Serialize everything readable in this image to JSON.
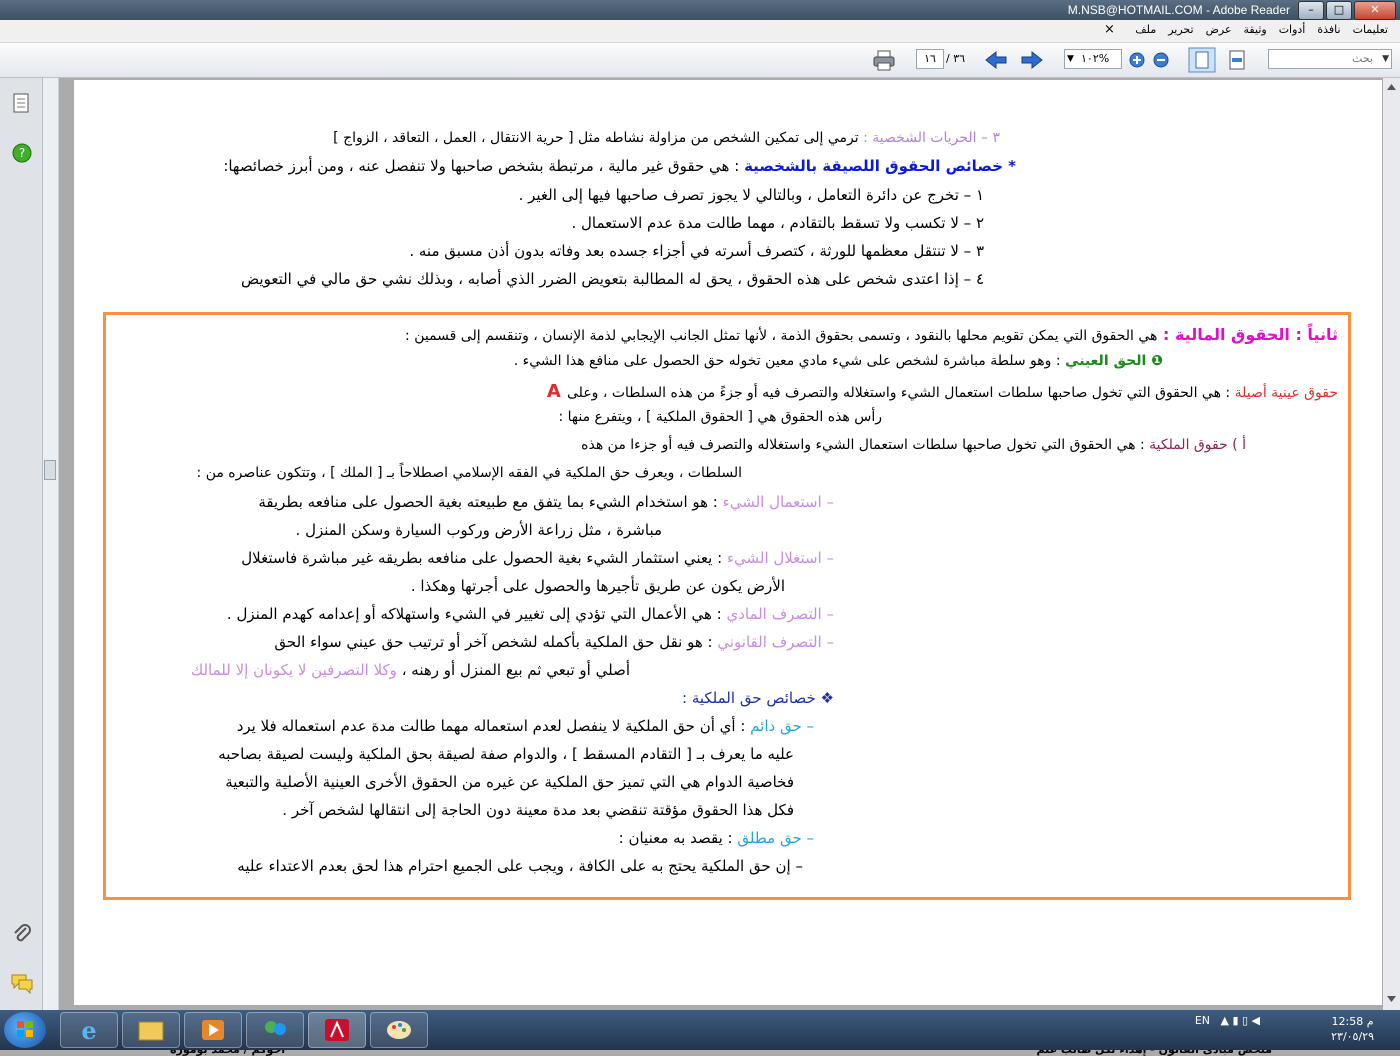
{
  "window": {
    "title": "M.NSB@HOTMAIL.COM - Adobe Reader"
  },
  "menu": {
    "items": [
      "ملف",
      "تحرير",
      "عرض",
      "وثيقة",
      "أدوات",
      "نافذة",
      "تعليمات"
    ],
    "close": "×"
  },
  "toolbar": {
    "search_placeholder": "بحث",
    "zoom": "١٠٢%",
    "page_current": "١٦",
    "page_total": "/ ٣٦"
  },
  "document": {
    "l1_a": "٣ – الحريات الشخصية : ",
    "l1_b": "ترمي إلى تمكين الشخص من مزاولة نشاطه مثل [ حرية الانتقال ، العمل ، التعاقد ، الزواج ]",
    "l2_star": "* ",
    "l2_a": "خصائص الحقوق اللصيقة بالشخصية",
    "l2_b": " : هي حقوق غير مالية ، مرتبطة بشخص صاحبها ولا تنفصل عنه ، ومن أبرز خصائصها:",
    "l3": "١ – تخرج عن دائرة التعامل ، وبالتالي لا يجوز تصرف صاحبها فيها إلى الغير .",
    "l4": "٢ – لا تكسب ولا تسقط بالتقادم ، مهما طالت مدة عدم الاستعمال .",
    "l5": "٣ –   لا تنتقل معظمها للورثة ، كتصرف أسرته في أجزاء جسده بعد وفاته بدون أذن مسبق منه .",
    "l6": "٤ – إذا اعتدى شخص على هذه الحقوق ، يحق له المطالبة بتعويض الضرر الذي أصابه ، وبذلك نشي حق مالي في التعويض",
    "b1_a": "ثانياً : الحقوق المالية : ",
    "b1_b": "هي الحقوق التي يمكن تقويم محلها   بالنقود ، وتسمى بحقوق الذمة ، لأنها تمثل الجانب الإيجابي لذمة الإنسان ، وتنقسم إلى قسمين :",
    "b2_num": "❶",
    "b2_a": " الحق العيني",
    "b2_b": " : وهو سلطة مباشرة لشخص على شيء مادي معين تخوله حق الحصول على منافع هذا الشيء .",
    "b3_a": "A ",
    "b3_b": " حقوق عينية أصيلة",
    "b3_c": " : هي الحقوق التي تخول صاحبها سلطات استعمال الشيء واستغلاله والتصرف فيه أو جزءً من هذه السلطات ، وعلى",
    "b4": "رأس هذه الحقوق هي [ الحقوق الملكية ] ، ويتفرع منها :",
    "b5_a": "أ ) حقوق الملكية",
    "b5_b": " : هي الحقوق التي تخول صاحبها سلطات استعمال الشيء واستغلاله والتصرف فيه أو جزءا من هذه",
    "b6": "السلطات ، ويعرف حق الملكية في الفقه الإسلامي اصطلاحاً بـ [ الملك ] ، وتتكون عناصره من :",
    "b7_a": "–   استعمال الشيء",
    "b7_b": " : هو استخدام الشيء بما يتفق مع طبيعته بغية الحصول على منافعه بطريقة",
    "b8": "مباشرة ، مثل زراعة الأرض وركوب السيارة وسكن المنزل .",
    "b9_a": "–   استغلال الشيء",
    "b9_b": " : يعني استثمار الشيء بغية الحصول على منافعه بطريقه غير مباشرة فاستغلال",
    "b10": "الأرض يكون عن طريق تأجيرها والحصول على أجرتها وهكذا .",
    "b11_a": "–   التصرف المادي",
    "b11_b": " : هي الأعمال التي تؤدي إلى تغيير في الشيء واستهلاكه أو إعدامه كهدم المنزل .",
    "b12_a": "–   التصرف القانوني",
    "b12_b": " : هو نقل حق الملكية بأكمله   لشخص آخر أو ترتيب حق عيني سواء الحق",
    "b13_a": "أصلي أو تبعي ثم بيع المنزل أو رهنه ، ",
    "b13_b": "وكلا التصرفين لا يكونان إلا للمالك",
    "b14": "❖ خصائص حق الملكية :",
    "b15_a": "–   حق دائم",
    "b15_b": " : أي أن حق الملكية لا ينفصل لعدم استعماله مهما طالت مدة عدم استعماله فلا يرد",
    "b16": "عليه ما يعرف بـ [ التقادم المسقط ] ، والدوام صفة لصيقة بحق الملكية وليست لصيقة بصاحبه",
    "b17": "فخاصية الدوام هي التي تميز حق الملكية عن غيره من الحقوق الأخرى العينية الأصلية والتبعية",
    "b18": "فكل هذا الحقوق مؤقتة تنقضي بعد مدة معينة دون الحاجة إلى انتقالها لشخص آخر .",
    "b19_a": "–   حق مطلق",
    "b19_b": " : يقصد به معنيان :",
    "b20": "–   إن حق الملكية يحتج به على الكافة ، ويجب على الجميع احترام هذا لحق بعدم الاعتداء عليه",
    "footer_right": "ملخص مبادئ القانون  -   إهداء لكل طالب علم",
    "footer_left": "أخوكم  /  محمد بوموزة"
  },
  "taskbar": {
    "lang": "EN",
    "time": "12:58 م",
    "date": "٢٣/٠٥/٢٩"
  }
}
